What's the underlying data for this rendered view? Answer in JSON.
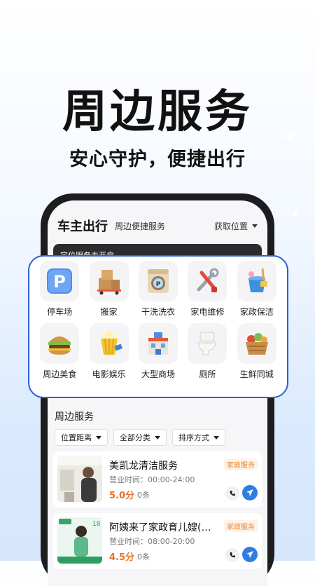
{
  "headline": "周边服务",
  "subline": "安心守护，便捷出行",
  "app": {
    "title": "车主出行",
    "subtitle": "周边便捷服务",
    "location_label": "获取位置",
    "banner_text": "定位服务未开启"
  },
  "categories": [
    {
      "label": "停车场",
      "icon": "parking-icon"
    },
    {
      "label": "搬家",
      "icon": "moving-boxes-icon"
    },
    {
      "label": "干洗洗衣",
      "icon": "washing-machine-icon"
    },
    {
      "label": "家电维修",
      "icon": "repair-tools-icon"
    },
    {
      "label": "家政保洁",
      "icon": "cleaning-bucket-icon"
    },
    {
      "label": "周边美食",
      "icon": "burger-icon"
    },
    {
      "label": "电影娱乐",
      "icon": "popcorn-icon"
    },
    {
      "label": "大型商场",
      "icon": "mall-building-icon"
    },
    {
      "label": "厕所",
      "icon": "toilet-icon"
    },
    {
      "label": "生鲜同城",
      "icon": "fresh-basket-icon"
    }
  ],
  "section_title": "周边服务",
  "filters": [
    "位置距离",
    "全部分类",
    "排序方式"
  ],
  "items": [
    {
      "name": "美凯龙清洁服务",
      "hours": "营业时间：00:00-24:00",
      "rating": "5.0分",
      "count": "0条",
      "tag": "家政服务"
    },
    {
      "name": "阿姨来了家政育儿嫂(…",
      "hours": "营业时间：08:00-20:00",
      "rating": "4.5分",
      "count": "0条",
      "tag": "家政服务"
    }
  ],
  "colors": {
    "accent": "#2d5fd8",
    "rating": "#e2752b",
    "nav": "#2d7de3"
  }
}
